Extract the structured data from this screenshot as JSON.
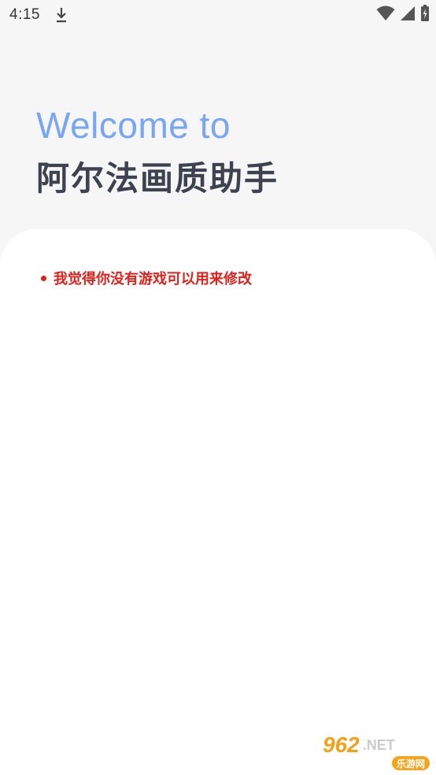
{
  "status_bar": {
    "time": "4:15",
    "icons": [
      "download-icon",
      "wifi-icon",
      "signal-icon",
      "battery-charging-icon"
    ]
  },
  "header": {
    "welcome": "Welcome to",
    "app_name": "阿尔法画质助手"
  },
  "notice": {
    "text": "我觉得你没有游戏可以用来修改",
    "color": "#e0201b"
  },
  "watermark": {
    "number": "962",
    "net": ".NET",
    "site": "乐游网"
  },
  "colors": {
    "accent_blue": "#78a6f5",
    "title_dark": "#3d4250",
    "background": "#f6f6f6",
    "card": "#ffffff"
  }
}
